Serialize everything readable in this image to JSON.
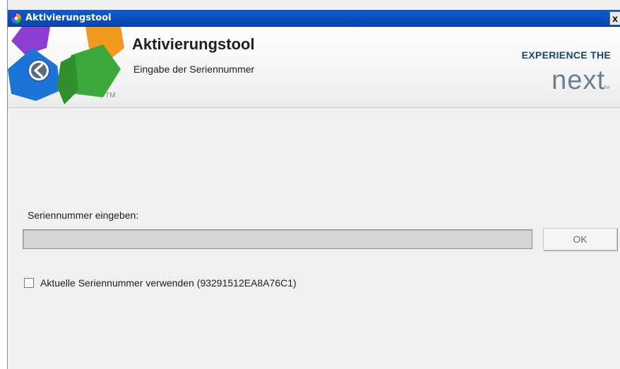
{
  "window": {
    "title": "Aktivierungstool",
    "close_label": "x"
  },
  "header": {
    "title": "Aktivierungstool",
    "subtitle": "Eingabe der Seriennummer",
    "tm": "TM",
    "brand_tagline": "EXPERIENCE THE",
    "brand_word": "next",
    "brand_tm": "TM"
  },
  "form": {
    "serial_label": "Seriennummer eingeben:",
    "serial_value": "",
    "ok_label": "OK",
    "checkbox_checked": false,
    "checkbox_label": "Aktuelle Seriennummer verwenden (93291512EA8A76C1)"
  },
  "colors": {
    "titlebar": "#0a4fc0",
    "brand_blue": "#17466f",
    "brand_gray": "#6d7f8c"
  },
  "icons": [
    "app-icon",
    "back-arrow-icon",
    "close-icon"
  ]
}
